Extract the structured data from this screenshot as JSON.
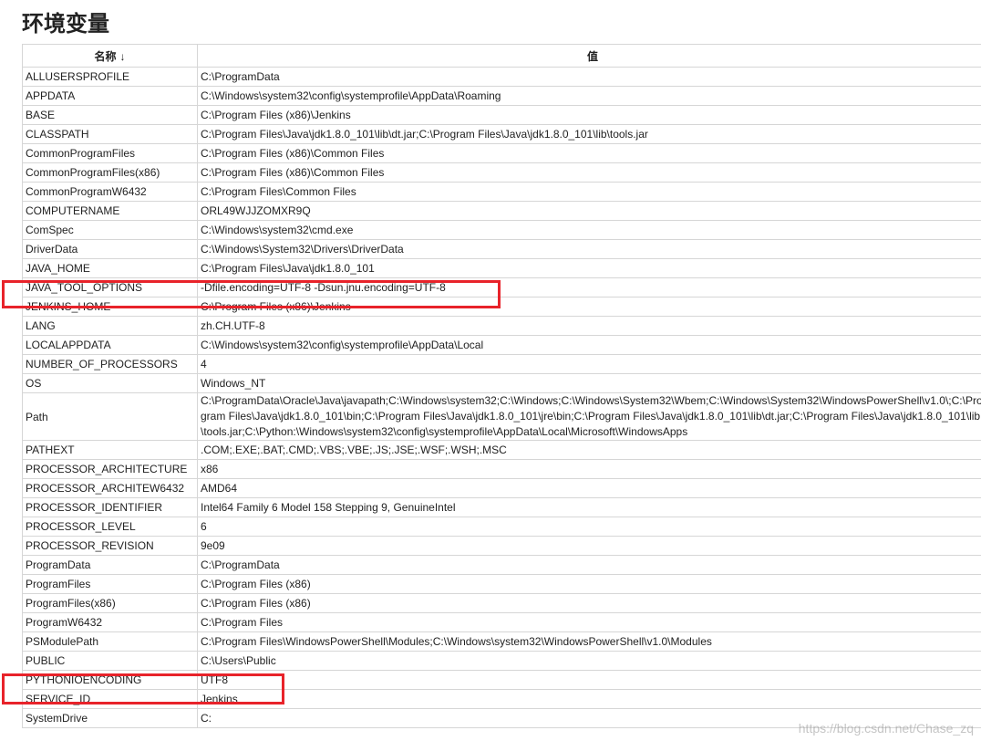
{
  "title": "环境变量",
  "table": {
    "header_name": "名称",
    "header_sort": "↓",
    "header_value": "值",
    "rows": [
      {
        "name": "ALLUSERSPROFILE",
        "value": "C:\\ProgramData"
      },
      {
        "name": "APPDATA",
        "value": "C:\\Windows\\system32\\config\\systemprofile\\AppData\\Roaming"
      },
      {
        "name": "BASE",
        "value": "C:\\Program Files (x86)\\Jenkins"
      },
      {
        "name": "CLASSPATH",
        "value": "C:\\Program Files\\Java\\jdk1.8.0_101\\lib\\dt.jar;C:\\Program Files\\Java\\jdk1.8.0_101\\lib\\tools.jar"
      },
      {
        "name": "CommonProgramFiles",
        "value": "C:\\Program Files (x86)\\Common Files"
      },
      {
        "name": "CommonProgramFiles(x86)",
        "value": "C:\\Program Files (x86)\\Common Files"
      },
      {
        "name": "CommonProgramW6432",
        "value": "C:\\Program Files\\Common Files"
      },
      {
        "name": "COMPUTERNAME",
        "value": "ORL49WJJZOMXR9Q"
      },
      {
        "name": "ComSpec",
        "value": "C:\\Windows\\system32\\cmd.exe"
      },
      {
        "name": "DriverData",
        "value": "C:\\Windows\\System32\\Drivers\\DriverData"
      },
      {
        "name": "JAVA_HOME",
        "value": "C:\\Program Files\\Java\\jdk1.8.0_101"
      },
      {
        "name": "JAVA_TOOL_OPTIONS",
        "value": "-Dfile.encoding=UTF-8 -Dsun.jnu.encoding=UTF-8"
      },
      {
        "name": "JENKINS_HOME",
        "value": "C:\\Program Files (x86)\\Jenkins"
      },
      {
        "name": "LANG",
        "value": "zh.CH.UTF-8"
      },
      {
        "name": "LOCALAPPDATA",
        "value": "C:\\Windows\\system32\\config\\systemprofile\\AppData\\Local"
      },
      {
        "name": "NUMBER_OF_PROCESSORS",
        "value": "4"
      },
      {
        "name": "OS",
        "value": "Windows_NT"
      },
      {
        "name": "Path",
        "value": "C:\\ProgramData\\Oracle\\Java\\javapath;C:\\Windows\\system32;C:\\Windows;C:\\Windows\\System32\\Wbem;C:\\Windows\\System32\\WindowsPowerShell\\v1.0\\;C:\\Program Files\\Java\\jdk1.8.0_101\\bin;C:\\Program Files\\Java\\jdk1.8.0_101\\jre\\bin;C:\\Program Files\\Java\\jdk1.8.0_101\\lib\\dt.jar;C:\\Program Files\\Java\\jdk1.8.0_101\\lib\\tools.jar;C:\\Python:\\Windows\\system32\\config\\systemprofile\\AppData\\Local\\Microsoft\\WindowsApps"
      },
      {
        "name": "PATHEXT",
        "value": ".COM;.EXE;.BAT;.CMD;.VBS;.VBE;.JS;.JSE;.WSF;.WSH;.MSC"
      },
      {
        "name": "PROCESSOR_ARCHITECTURE",
        "value": "x86"
      },
      {
        "name": "PROCESSOR_ARCHITEW6432",
        "value": "AMD64"
      },
      {
        "name": "PROCESSOR_IDENTIFIER",
        "value": "Intel64 Family 6 Model 158 Stepping 9, GenuineIntel"
      },
      {
        "name": "PROCESSOR_LEVEL",
        "value": "6"
      },
      {
        "name": "PROCESSOR_REVISION",
        "value": "9e09"
      },
      {
        "name": "ProgramData",
        "value": "C:\\ProgramData"
      },
      {
        "name": "ProgramFiles",
        "value": "C:\\Program Files (x86)"
      },
      {
        "name": "ProgramFiles(x86)",
        "value": "C:\\Program Files (x86)"
      },
      {
        "name": "ProgramW6432",
        "value": "C:\\Program Files"
      },
      {
        "name": "PSModulePath",
        "value": "C:\\Program Files\\WindowsPowerShell\\Modules;C:\\Windows\\system32\\WindowsPowerShell\\v1.0\\Modules"
      },
      {
        "name": "PUBLIC",
        "value": "C:\\Users\\Public"
      },
      {
        "name": "PYTHONIOENCODING",
        "value": "UTF8"
      },
      {
        "name": "SERVICE_ID",
        "value": "Jenkins"
      },
      {
        "name": "SystemDrive",
        "value": "C:"
      }
    ]
  },
  "highlight_color": "#e8232a",
  "watermark": "https://blog.csdn.net/Chase_zq"
}
